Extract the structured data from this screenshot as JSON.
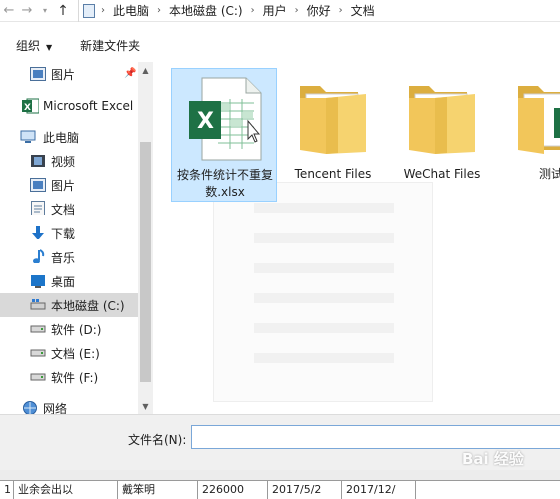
{
  "address_bar": {
    "breadcrumbs": [
      "此电脑",
      "本地磁盘 (C:)",
      "用户",
      "你好",
      "文档"
    ]
  },
  "toolbar": {
    "organize_label": "组织",
    "new_folder_label": "新建文件夹"
  },
  "nav": {
    "items": [
      {
        "label": "图片",
        "icon": "pictures-icon"
      },
      {
        "label": "Microsoft Excel",
        "icon": "excel-icon"
      },
      {
        "label": "此电脑",
        "icon": "computer-icon"
      },
      {
        "label": "视频",
        "icon": "videos-icon"
      },
      {
        "label": "图片",
        "icon": "pictures-icon"
      },
      {
        "label": "文档",
        "icon": "documents-icon"
      },
      {
        "label": "下载",
        "icon": "download-icon"
      },
      {
        "label": "音乐",
        "icon": "music-icon"
      },
      {
        "label": "桌面",
        "icon": "desktop-icon"
      },
      {
        "label": "本地磁盘 (C:)",
        "icon": "drive-icon"
      },
      {
        "label": "软件 (D:)",
        "icon": "drive-icon"
      },
      {
        "label": "文档 (E:)",
        "icon": "drive-icon"
      },
      {
        "label": "软件 (F:)",
        "icon": "drive-icon"
      },
      {
        "label": "网络",
        "icon": "network-icon"
      }
    ],
    "selected_index": 9
  },
  "files": {
    "items": [
      {
        "name": "按条件统计不重复数.xlsx",
        "type": "excel-file",
        "selected": true
      },
      {
        "name": "Tencent Files",
        "type": "folder"
      },
      {
        "name": "WeChat Files",
        "type": "folder"
      },
      {
        "name": "测试",
        "type": "folder"
      }
    ]
  },
  "bottom": {
    "filename_label": "文件名(N):",
    "filename_value": ""
  },
  "background_sheet": {
    "cells": [
      "1",
      "业余会出以",
      "戴笨明",
      "226000",
      "2017/5/2",
      "2017/12/"
    ]
  },
  "watermark": "Bai 经验",
  "colors": {
    "accent": "#cce8ff",
    "selection_border": "#99d1ff",
    "excel_green": "#1e7145",
    "folder_yellow": "#f2c65a"
  }
}
